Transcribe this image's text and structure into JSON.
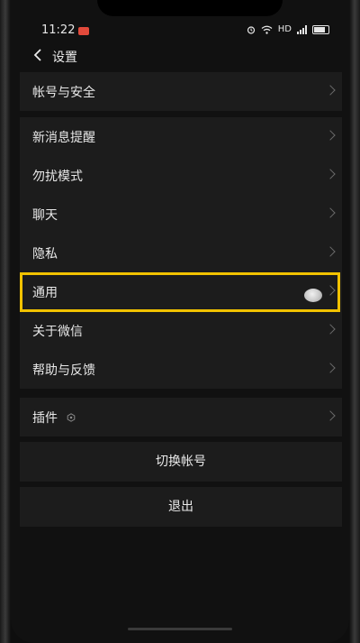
{
  "status_bar": {
    "time": "11:22",
    "network": "HD"
  },
  "header": {
    "title": "设置"
  },
  "groups": [
    {
      "items": [
        {
          "label": "帐号与安全"
        }
      ]
    },
    {
      "items": [
        {
          "label": "新消息提醒"
        },
        {
          "label": "勿扰模式"
        },
        {
          "label": "聊天"
        },
        {
          "label": "隐私"
        },
        {
          "label": "通用"
        },
        {
          "label": "关于微信"
        },
        {
          "label": "帮助与反馈"
        }
      ]
    },
    {
      "items": [
        {
          "label": "插件"
        }
      ]
    }
  ],
  "actions": {
    "switch_account": "切换帐号",
    "logout": "退出"
  },
  "highlight": {
    "target": "通用",
    "color": "#f2c200"
  },
  "colors": {
    "background": "#111111",
    "row_bg": "#1c1c1c",
    "text": "#e8e8e8"
  },
  "icons": {
    "back": "chevron-left-icon",
    "row": "chevron-right-icon",
    "plugin": "hexagon-icon"
  }
}
